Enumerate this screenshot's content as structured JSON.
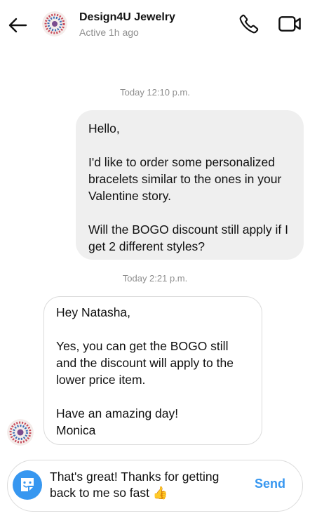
{
  "header": {
    "title": "Design4U Jewelry",
    "status": "Active 1h ago",
    "icons": [
      "back-arrow-icon",
      "phone-icon",
      "video-camera-icon"
    ]
  },
  "thread": {
    "timestamp_1": "Today 12:10 p.m.",
    "outgoing_message": "Hello,\n\nI'd like to order some personalized bracelets similar to the ones in your Valentine story.\n\nWill the BOGO discount still apply if I get 2 different styles?",
    "timestamp_2": "Today 2:21 p.m.",
    "incoming_message": "Hey Natasha,\n\nYes, you can get the BOGO still and the discount will apply to the lower price item.\n\nHave an amazing day!\nMonica"
  },
  "composer": {
    "draft_text": "That's great! Thanks for getting back to me so fast",
    "emoji": "👍",
    "send_label": "Send"
  },
  "colors": {
    "accent": "#3797f0",
    "outgoing_bubble": "#efefef",
    "muted_text": "#8e8e8e"
  }
}
